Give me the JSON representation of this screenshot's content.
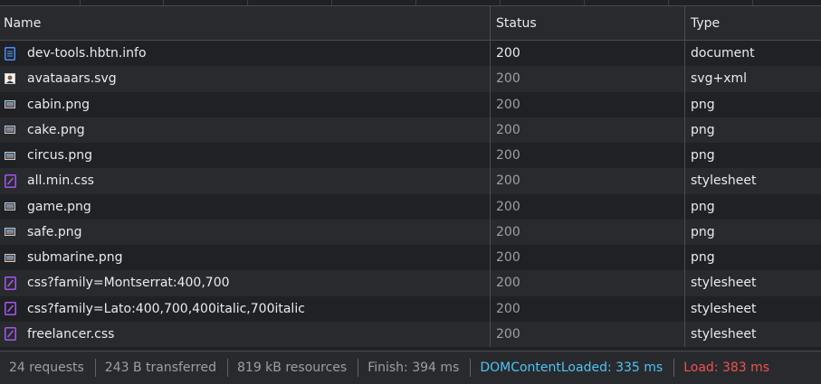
{
  "columns": {
    "name": "Name",
    "status": "Status",
    "type": "Type"
  },
  "rows": [
    {
      "name": "dev-tools.hbtn.info",
      "status": "200",
      "type": "document",
      "icon": "document-icon",
      "primary": true
    },
    {
      "name": "avataaars.svg",
      "status": "200",
      "type": "svg+xml",
      "icon": "avatar-image-icon"
    },
    {
      "name": "cabin.png",
      "status": "200",
      "type": "png",
      "icon": "image-icon"
    },
    {
      "name": "cake.png",
      "status": "200",
      "type": "png",
      "icon": "image-icon"
    },
    {
      "name": "circus.png",
      "status": "200",
      "type": "png",
      "icon": "image-icon"
    },
    {
      "name": "all.min.css",
      "status": "200",
      "type": "stylesheet",
      "icon": "stylesheet-icon"
    },
    {
      "name": "game.png",
      "status": "200",
      "type": "png",
      "icon": "image-icon"
    },
    {
      "name": "safe.png",
      "status": "200",
      "type": "png",
      "icon": "image-icon"
    },
    {
      "name": "submarine.png",
      "status": "200",
      "type": "png",
      "icon": "image-icon"
    },
    {
      "name": "css?family=Montserrat:400,700",
      "status": "200",
      "type": "stylesheet",
      "icon": "stylesheet-icon"
    },
    {
      "name": "css?family=Lato:400,700,400italic,700italic",
      "status": "200",
      "type": "stylesheet",
      "icon": "stylesheet-icon"
    },
    {
      "name": "freelancer.css",
      "status": "200",
      "type": "stylesheet",
      "icon": "stylesheet-icon"
    }
  ],
  "footer": {
    "requests": "24 requests",
    "transferred": "243 B transferred",
    "resources": "819 kB resources",
    "finish": "Finish: 394 ms",
    "dom_content_loaded": "DOMContentLoaded: 335 ms",
    "load": "Load: 383 ms"
  },
  "colors": {
    "background": "#202124",
    "alt_row": "#292a2d",
    "dom_content_loaded": "#4fc3f7",
    "load": "#ef5350",
    "stylesheet_icon": "#a259e6",
    "document_icon": "#4b8ef5"
  }
}
